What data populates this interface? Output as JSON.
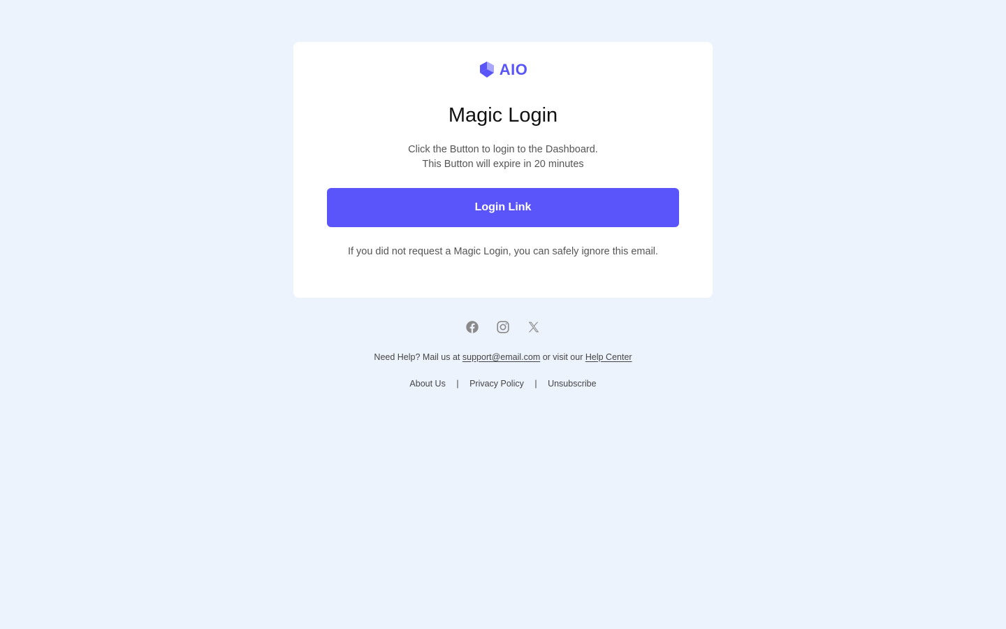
{
  "brand": {
    "name": "AIO",
    "color": "#5a55f9",
    "logo_icon": "cube-logo-icon"
  },
  "email": {
    "title": "Magic Login",
    "description_line1": "Click the Button to login to the Dashboard.",
    "description_line2": "This Button will expire in 20 minutes",
    "button_label": "Login Link",
    "button_color": "#5a55fb",
    "ignore_note": "If you did not request a Magic Login, you can safely ignore this email."
  },
  "social": [
    {
      "name": "facebook-icon"
    },
    {
      "name": "instagram-icon"
    },
    {
      "name": "x-icon"
    }
  ],
  "help": {
    "prefix": "Need Help? Mail us at",
    "email": "support@email.com",
    "middle": "or visit our",
    "help_center": "Help Center"
  },
  "footer": {
    "about": "About Us",
    "separator": "|",
    "privacy": "Privacy Policy",
    "unsubscribe": "Unsubscribe"
  },
  "colors": {
    "background": "#edf3fd",
    "card": "#ffffff",
    "text_muted": "#555555"
  }
}
